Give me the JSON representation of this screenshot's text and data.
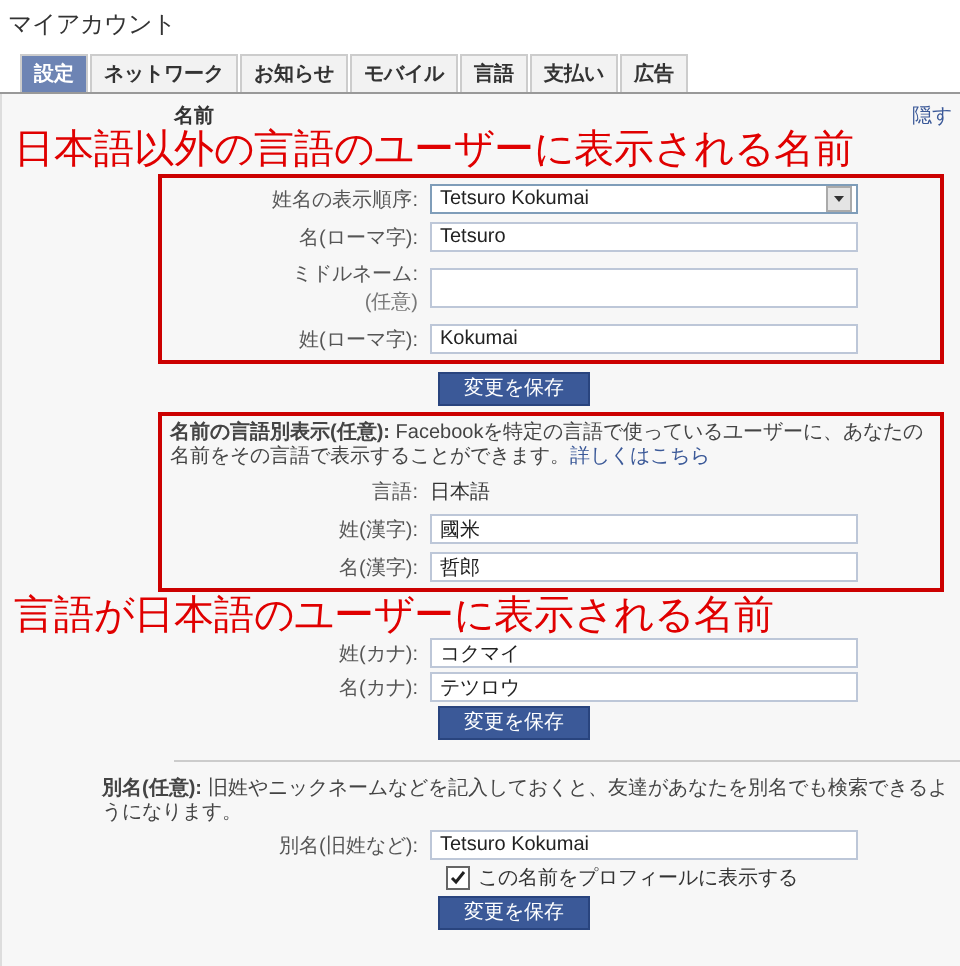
{
  "page_title": "マイアカウント",
  "tabs": [
    {
      "label": "設定",
      "selected": true
    },
    {
      "label": "ネットワーク",
      "selected": false
    },
    {
      "label": "お知らせ",
      "selected": false
    },
    {
      "label": "モバイル",
      "selected": false
    },
    {
      "label": "言語",
      "selected": false
    },
    {
      "label": "支払い",
      "selected": false
    },
    {
      "label": "広告",
      "selected": false
    }
  ],
  "name_section": {
    "heading": "名前",
    "hide_link": "隠す",
    "annotation": "日本語以外の言語のユーザーに表示される名前",
    "fields": [
      {
        "kind": "select",
        "label": "姓名の表示順序:",
        "value": "Tetsuro Kokumai"
      },
      {
        "kind": "text",
        "label": "名(ローマ字):",
        "value": "Tetsuro"
      },
      {
        "kind": "text",
        "label": "ミドルネーム:",
        "note": "(任意)"
      },
      {
        "kind": "text",
        "label": "姓(ローマ字):",
        "value": "Kokumai"
      }
    ],
    "save_button": "変更を保存"
  },
  "language_section": {
    "description": "**名前の言語別表示(任意):** Facebookを特定の言語で使っているユーザーに、あなたの名前をその言語で表示することができます。",
    "link": "詳しくはこちら",
    "language_label": "言語:",
    "language_value": "日本語",
    "fields": [
      {
        "kind": "text",
        "label": "姓(漢字):",
        "value": "國米"
      },
      {
        "kind": "text",
        "label": "名(漢字):",
        "value": "哲郎"
      }
    ],
    "annotation": "言語が日本語のユーザーに表示される名前",
    "kana_fields": [
      {
        "kind": "text",
        "label": "姓(カナ):",
        "value": "コクマイ"
      },
      {
        "kind": "text",
        "label": "名(カナ):",
        "value": "テツロウ"
      }
    ],
    "save_button": "変更を保存"
  },
  "alias_section": {
    "description": "**別名(任意):** 旧姓やニックネームなどを記入しておくと、友達があなたを別名でも検索できるようになります。",
    "fields": [
      {
        "kind": "text",
        "label": "別名(旧姓など):",
        "value": "Tetsuro Kokumai"
      }
    ],
    "checkbox": {
      "label": "この名前をプロフィールに表示する",
      "checked": true
    },
    "save_button": "変更を保存"
  }
}
